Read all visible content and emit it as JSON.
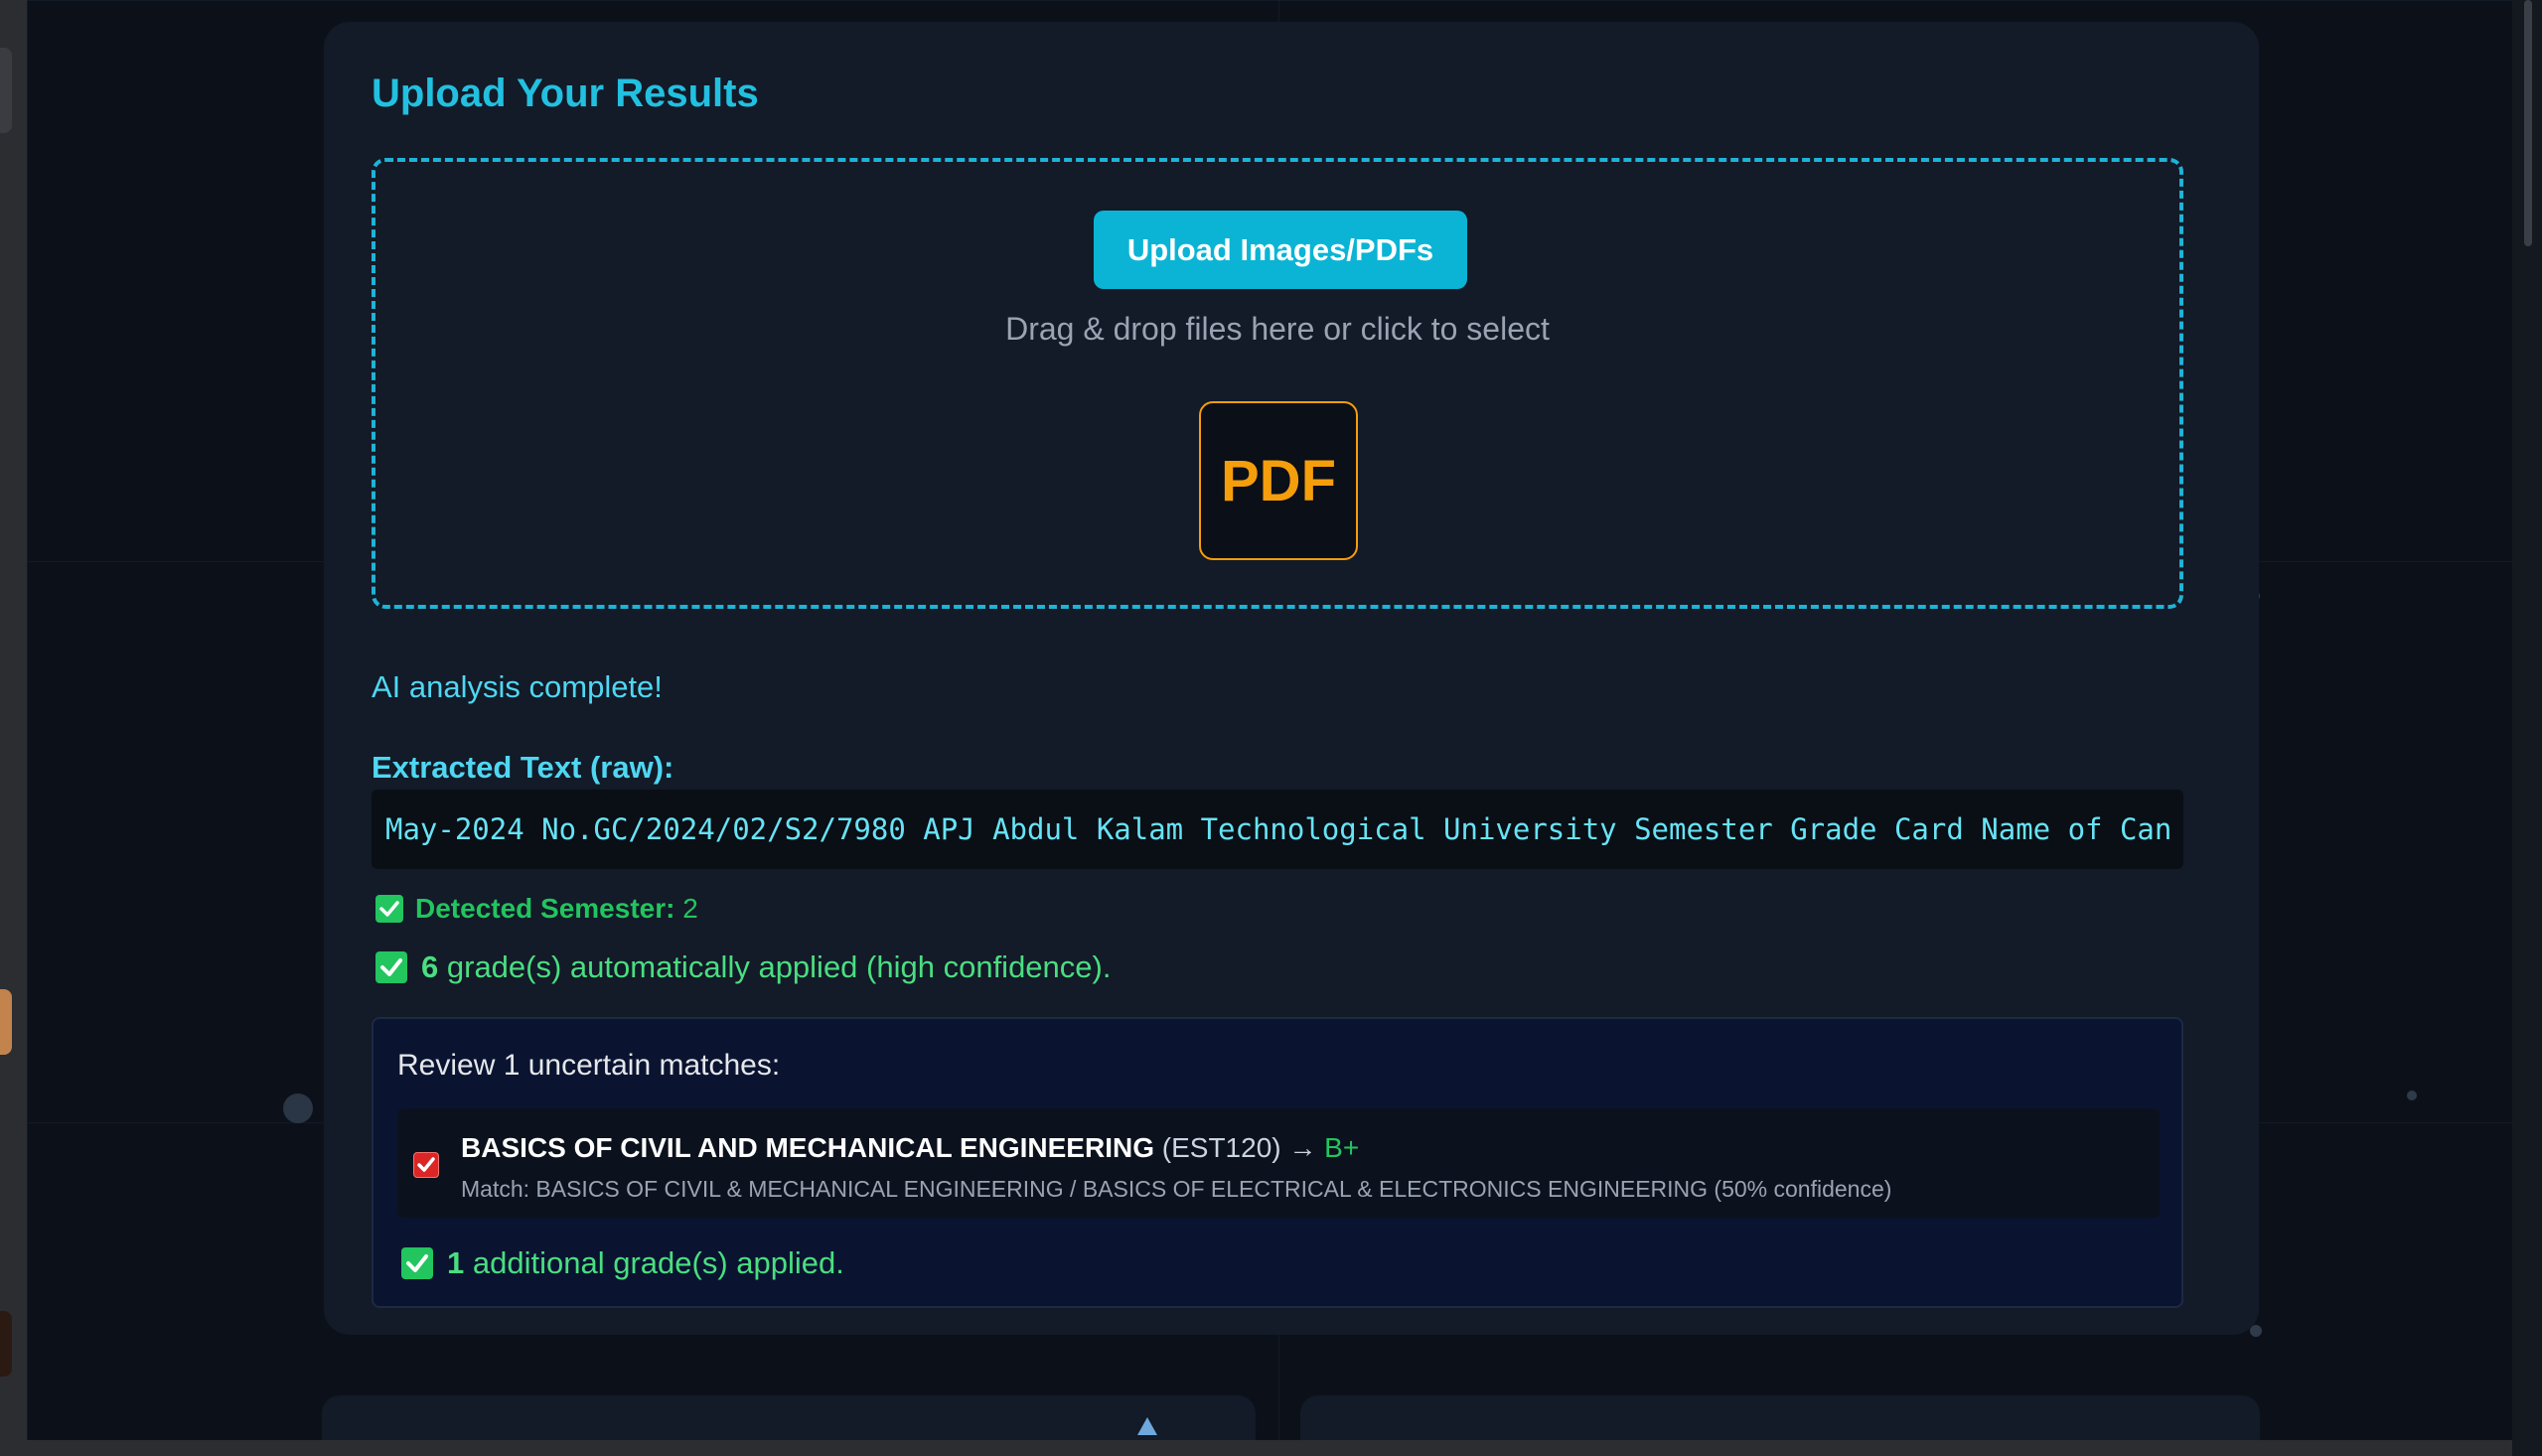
{
  "card": {
    "title": "Upload Your Results",
    "upload_button": "Upload Images/PDFs",
    "drop_hint": "Drag & drop files here or click to select",
    "file_icon_label": "PDF",
    "status": "AI analysis complete!",
    "extracted_label": "Extracted Text (raw):",
    "extracted_text": "May-2024 No.GC/2024/02/S2/7980 APJ Abdul Kalam Technological University Semester Grade Card Name of Can"
  },
  "detected": {
    "label": "Detected Semester:",
    "value": "2"
  },
  "applied": {
    "count": "6",
    "text": "grade(s) automatically applied (high confidence)."
  },
  "review": {
    "title": "Review 1 uncertain matches:",
    "items": [
      {
        "subject": "BASICS OF CIVIL AND MECHANICAL ENGINEERING",
        "code": "(EST120) →",
        "grade": "B+",
        "match": "Match: BASICS OF CIVIL & MECHANICAL ENGINEERING / BASICS OF ELECTRICAL & ELECTRONICS ENGINEERING (50% confidence)",
        "checked": true
      }
    ],
    "additional_count": "1",
    "additional_text": "additional grade(s) applied."
  },
  "colors": {
    "accent": "#0bb4d4",
    "title": "#22c0e0",
    "success": "#22c55e",
    "pdf": "#f59e0b",
    "uncertain": "#dc2626"
  },
  "icons": [
    "pdf-file-icon",
    "check-icon",
    "checkbox-checked-red-icon",
    "scroll-up-arrow-icon"
  ]
}
